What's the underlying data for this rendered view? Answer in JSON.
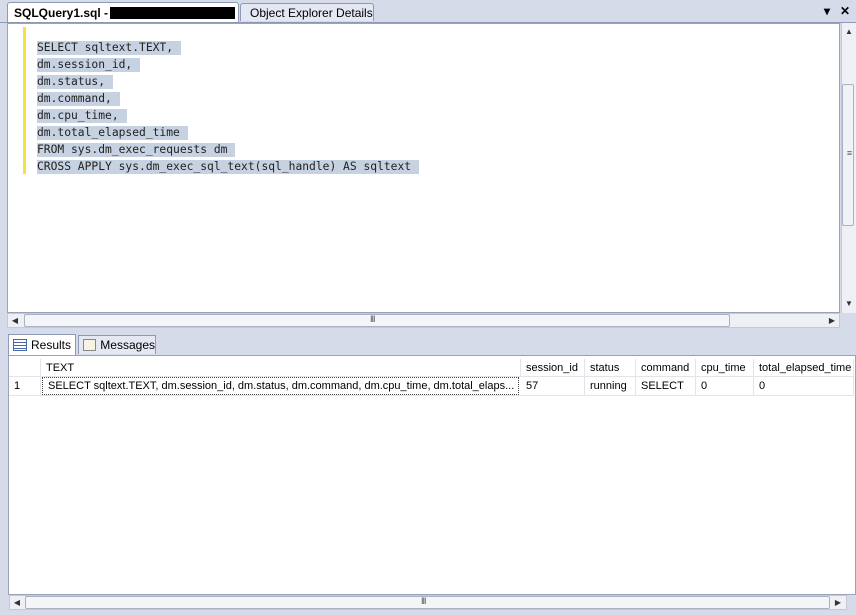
{
  "tabs": {
    "query_tab": "SQLQuery1.sql -",
    "object_explorer_tab": "Object Explorer Details"
  },
  "window_buttons": {
    "dropdown_icon": "triangle-down-icon",
    "close_icon": "close-icon"
  },
  "editor": {
    "lines": [
      "SELECT sqltext.TEXT,",
      "dm.session_id,",
      "dm.status,",
      "dm.command,",
      "dm.cpu_time,",
      "dm.total_elapsed_time",
      "FROM sys.dm_exec_requests dm",
      "CROSS APPLY sys.dm_exec_sql_text(sql_handle) AS sqltext"
    ],
    "selection_color": "#c6d1e2",
    "change_marker_color": "#f2e23a"
  },
  "results_tabs": {
    "results_label": "Results",
    "messages_label": "Messages"
  },
  "grid": {
    "columns": [
      "TEXT",
      "session_id",
      "status",
      "command",
      "cpu_time",
      "total_elapsed_time"
    ],
    "rows": [
      {
        "row_number": "1",
        "text": "SELECT sqltext.TEXT,  dm.session_id,  dm.status,  dm.command,  dm.cpu_time,  dm.total_elaps...",
        "session_id": "57",
        "status": "running",
        "command": "SELECT",
        "cpu_time": "0",
        "total_elapsed_time": "0"
      }
    ]
  },
  "scroll": {
    "grip": "III",
    "vgrip": "≡",
    "left_arrow": "◀",
    "right_arrow": "▶",
    "up_arrow": "▲",
    "down_arrow": "▼"
  }
}
